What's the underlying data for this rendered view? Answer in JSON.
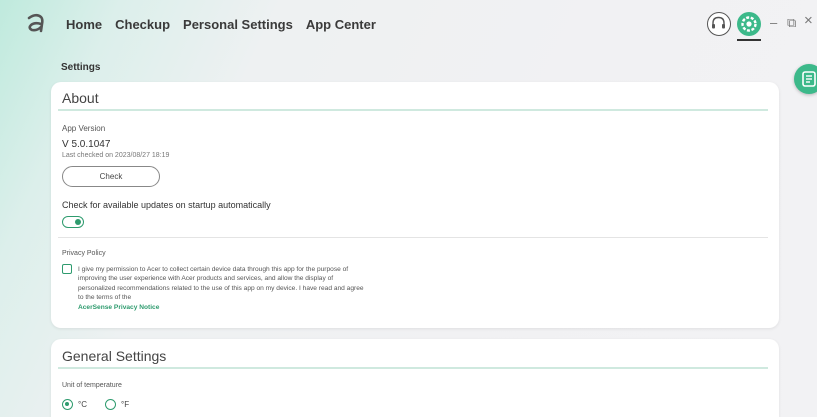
{
  "nav": {
    "home": "Home",
    "checkup": "Checkup",
    "personal_settings": "Personal Settings",
    "app_center": "App Center"
  },
  "window": {
    "minimize": "–",
    "restore": "⧉",
    "close": "×"
  },
  "page": {
    "section_title": "Settings"
  },
  "about": {
    "title": "About",
    "app_version_label": "App Version",
    "version": "V 5.0.1047",
    "last_checked": "Last checked on 2023/08/27 18:19",
    "check_button": "Check",
    "auto_update_label": "Check for available updates on startup automatically",
    "auto_update_on": true,
    "privacy_label": "Privacy Policy",
    "privacy_text": "I give my permission to Acer to collect certain device data through this app for the purpose of improving the user experience with Acer products and services, and allow the display of personalized recommendations related to the use of this app on my device. I have read and agree to the terms of the",
    "privacy_link": "AcerSense Privacy Notice",
    "privacy_checked": false
  },
  "general": {
    "title": "General Settings",
    "unit_label": "Unit of temperature",
    "celsius": "°C",
    "fahrenheit": "°F",
    "selected": "celsius"
  },
  "icons": {
    "logo": "acer-a-icon",
    "support": "headset-icon",
    "settings": "gear-icon",
    "floating": "notes-icon"
  },
  "colors": {
    "accent": "#3cb98a",
    "accent_dark": "#2e9b6e"
  }
}
